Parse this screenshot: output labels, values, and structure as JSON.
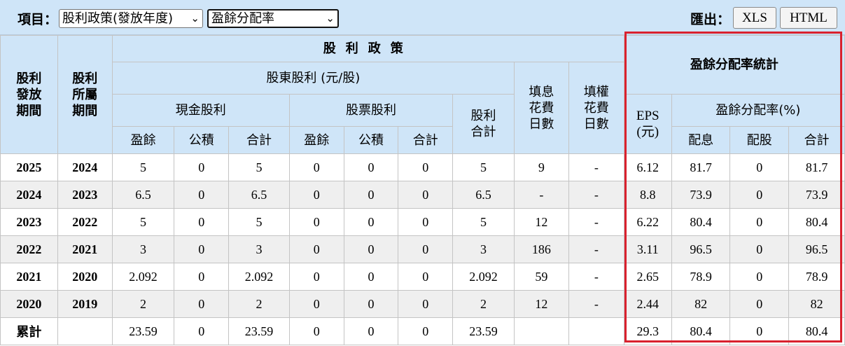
{
  "toolbar": {
    "item_label": "項目：",
    "select1_value": "股利政策(發放年度)",
    "select2_value": "盈餘分配率",
    "export_label": "匯出：",
    "xls_label": "XLS",
    "html_label": "HTML"
  },
  "headers": {
    "period_pay": "股利發放期間",
    "period_belong": "股利所屬期間",
    "policy": "股利政策",
    "shareholder": "股東股利 (元/股)",
    "cash": "現金股利",
    "stock": "股票股利",
    "div_total": "股利合計",
    "fill_div_days": "填息花費日數",
    "fill_right_days": "填權花費日數",
    "payout_stats": "盈餘分配率統計",
    "eps": "EPS (元)",
    "payout_ratio": "盈餘分配率(%)",
    "earnings": "盈餘",
    "capital_reserve": "公積",
    "total": "合計",
    "div_payout": "配息",
    "stock_payout": "配股"
  },
  "rows": [
    [
      "2025",
      "2024",
      "5",
      "0",
      "5",
      "0",
      "0",
      "0",
      "5",
      "9",
      "-",
      "6.12",
      "81.7",
      "0",
      "81.7"
    ],
    [
      "2024",
      "2023",
      "6.5",
      "0",
      "6.5",
      "0",
      "0",
      "0",
      "6.5",
      "-",
      "-",
      "8.8",
      "73.9",
      "0",
      "73.9"
    ],
    [
      "2023",
      "2022",
      "5",
      "0",
      "5",
      "0",
      "0",
      "0",
      "5",
      "12",
      "-",
      "6.22",
      "80.4",
      "0",
      "80.4"
    ],
    [
      "2022",
      "2021",
      "3",
      "0",
      "3",
      "0",
      "0",
      "0",
      "3",
      "186",
      "-",
      "3.11",
      "96.5",
      "0",
      "96.5"
    ],
    [
      "2021",
      "2020",
      "2.092",
      "0",
      "2.092",
      "0",
      "0",
      "0",
      "2.092",
      "59",
      "-",
      "2.65",
      "78.9",
      "0",
      "78.9"
    ],
    [
      "2020",
      "2019",
      "2",
      "0",
      "2",
      "0",
      "0",
      "0",
      "2",
      "12",
      "-",
      "2.44",
      "82",
      "0",
      "82"
    ],
    [
      "累計",
      "",
      "23.59",
      "0",
      "23.59",
      "0",
      "0",
      "0",
      "23.59",
      "",
      "",
      "29.3",
      "80.4",
      "0",
      "80.4"
    ]
  ],
  "colors": {
    "header_bg": "#cfe5f8",
    "highlight": "#d9212e",
    "stripe": "#efefef"
  }
}
